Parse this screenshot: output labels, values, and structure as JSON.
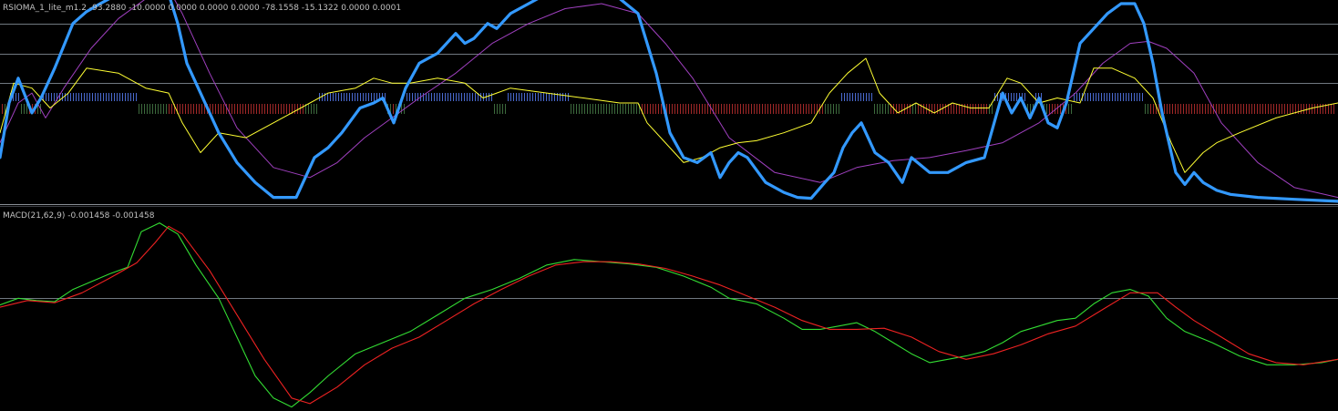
{
  "chart_data": [
    {
      "type": "line",
      "label": "RSIOMA_1_lite_m1.2 -93.2880 -10.0000 0.0000 0.0000 0.0000 -78.1558 -15.1322 0.0000 0.0001",
      "levels": [
        80,
        50,
        20
      ],
      "ylim": [
        -100,
        100
      ],
      "colors": {
        "rsioma": "#3399ff",
        "ma": "#a040c0",
        "signal": "#ffff33",
        "level": "#707880",
        "histogram_up": "#4a6ad0",
        "histogram_down": "#a02828",
        "histogram_neutral": "#3d6a3d"
      },
      "series": [
        {
          "key": "rsioma",
          "x": [
            0,
            10,
            20,
            35,
            45,
            60,
            80,
            95,
            110,
            130,
            160,
            185,
            195,
            205,
            220,
            240,
            260,
            280,
            300,
            325,
            335,
            345,
            360,
            375,
            395,
            410,
            420,
            432,
            445,
            460,
            480,
            500,
            510,
            520,
            535,
            545,
            560,
            580,
            600,
            620,
            640,
            660,
            680,
            700,
            710,
            720,
            735,
            750,
            765,
            780,
            790,
            800,
            810,
            820,
            840,
            860,
            875,
            890,
            905,
            915,
            925,
            935,
            945,
            960,
            975,
            990,
            1000,
            1020,
            1040,
            1060,
            1080,
            1100,
            1110,
            1120,
            1130,
            1140,
            1150,
            1160,
            1170,
            1185,
            1200,
            1215,
            1230,
            1245,
            1255,
            1265,
            1275,
            1290,
            1300,
            1310,
            1320,
            1335,
            1350,
            1380,
            1420,
            1468
          ],
          "values": [
            -55,
            0,
            25,
            -10,
            5,
            35,
            80,
            92,
            100,
            110,
            120,
            110,
            80,
            40,
            10,
            -30,
            -60,
            -80,
            -95,
            -95,
            -75,
            -55,
            -45,
            -30,
            -5,
            0,
            5,
            -20,
            15,
            40,
            50,
            70,
            60,
            65,
            80,
            75,
            90,
            100,
            110,
            115,
            110,
            112,
            105,
            90,
            60,
            30,
            -30,
            -55,
            -60,
            -50,
            -75,
            -60,
            -50,
            -55,
            -80,
            -90,
            -95,
            -96,
            -80,
            -70,
            -45,
            -30,
            -20,
            -50,
            -60,
            -80,
            -55,
            -70,
            -70,
            -60,
            -55,
            10,
            -10,
            5,
            -15,
            5,
            -20,
            -25,
            0,
            60,
            75,
            90,
            100,
            100,
            80,
            40,
            -10,
            -70,
            -82,
            -70,
            -80,
            -88,
            -92,
            -95,
            -97,
            -99
          ]
        },
        {
          "key": "ma",
          "x": [
            0,
            20,
            35,
            50,
            70,
            100,
            130,
            160,
            185,
            200,
            230,
            260,
            300,
            340,
            370,
            400,
            430,
            460,
            500,
            540,
            580,
            620,
            660,
            700,
            730,
            760,
            800,
            850,
            900,
            940,
            980,
            1020,
            1060,
            1100,
            1140,
            1180,
            1210,
            1240,
            1260,
            1280,
            1310,
            1340,
            1380,
            1420,
            1468
          ],
          "values": [
            -40,
            0,
            10,
            -15,
            15,
            55,
            85,
            105,
            115,
            90,
            30,
            -25,
            -65,
            -75,
            -60,
            -35,
            -15,
            5,
            30,
            60,
            80,
            95,
            100,
            90,
            60,
            25,
            -35,
            -70,
            -80,
            -65,
            -58,
            -55,
            -48,
            -40,
            -20,
            10,
            40,
            60,
            62,
            55,
            30,
            -20,
            -60,
            -85,
            -95
          ]
        },
        {
          "key": "signal",
          "x": [
            0,
            15,
            35,
            55,
            75,
            95,
            130,
            160,
            185,
            200,
            220,
            240,
            270,
            300,
            330,
            360,
            390,
            410,
            430,
            450,
            480,
            510,
            530,
            545,
            560,
            600,
            640,
            680,
            700,
            710,
            730,
            750,
            770,
            790,
            810,
            830,
            860,
            890,
            910,
            930,
            950,
            965,
            985,
            1005,
            1025,
            1045,
            1065,
            1085,
            1105,
            1120,
            1140,
            1160,
            1185,
            1200,
            1220,
            1245,
            1265,
            1285,
            1300,
            1320,
            1335,
            1360,
            1400,
            1440,
            1468
          ],
          "values": [
            -30,
            20,
            15,
            -5,
            10,
            35,
            30,
            15,
            10,
            -20,
            -50,
            -30,
            -35,
            -20,
            -5,
            10,
            15,
            25,
            20,
            20,
            25,
            20,
            5,
            10,
            15,
            10,
            5,
            0,
            0,
            -20,
            -40,
            -60,
            -55,
            -45,
            -40,
            -38,
            -30,
            -20,
            10,
            30,
            45,
            10,
            -10,
            0,
            -10,
            0,
            -5,
            -5,
            25,
            20,
            0,
            5,
            0,
            35,
            35,
            25,
            5,
            -40,
            -70,
            -50,
            -40,
            -30,
            -15,
            -5,
            0
          ]
        }
      ]
    },
    {
      "type": "line",
      "label": "MACD(21,62,9) -0.001458 -0.001458",
      "levels": [
        0
      ],
      "ylim": [
        -0.01,
        0.008
      ],
      "colors": {
        "macd": "#33dd33",
        "signal": "#ee2222",
        "level": "#707880"
      },
      "series": [
        {
          "key": "macd",
          "x": [
            0,
            20,
            40,
            60,
            80,
            100,
            120,
            140,
            155,
            175,
            195,
            215,
            240,
            260,
            280,
            300,
            320,
            340,
            360,
            390,
            420,
            450,
            480,
            510,
            540,
            570,
            600,
            630,
            660,
            690,
            720,
            750,
            780,
            800,
            830,
            860,
            880,
            900,
            920,
            940,
            960,
            980,
            1000,
            1020,
            1040,
            1060,
            1080,
            1100,
            1120,
            1140,
            1160,
            1180,
            1200,
            1220,
            1240,
            1260,
            1280,
            1300,
            1330,
            1360,
            1390,
            1420,
            1450,
            1468
          ],
          "values": [
            -0.0006,
            0,
            -0.0002,
            -0.0003,
            0.0008,
            0.0015,
            0.0022,
            0.0028,
            0.006,
            0.0068,
            0.0058,
            0.003,
            0,
            -0.0035,
            -0.007,
            -0.009,
            -0.0098,
            -0.0085,
            -0.007,
            -0.005,
            -0.004,
            -0.003,
            -0.0015,
            0,
            0.0008,
            0.0018,
            0.003,
            0.0035,
            0.0033,
            0.0031,
            0.0028,
            0.002,
            0.001,
            0,
            -0.0005,
            -0.0018,
            -0.0028,
            -0.0028,
            -0.0025,
            -0.0022,
            -0.003,
            -0.004,
            -0.005,
            -0.0058,
            -0.0055,
            -0.0052,
            -0.0048,
            -0.004,
            -0.003,
            -0.0025,
            -0.002,
            -0.0018,
            -0.0005,
            0.0005,
            0.0008,
            0.0002,
            -0.0018,
            -0.003,
            -0.004,
            -0.0052,
            -0.006,
            -0.006,
            -0.0058,
            -0.0055
          ]
        },
        {
          "key": "signal",
          "x": [
            0,
            30,
            60,
            90,
            120,
            150,
            170,
            185,
            200,
            230,
            260,
            290,
            320,
            340,
            370,
            400,
            430,
            460,
            490,
            520,
            550,
            580,
            610,
            640,
            670,
            700,
            730,
            760,
            790,
            820,
            850,
            880,
            910,
            940,
            970,
            1000,
            1030,
            1060,
            1090,
            1120,
            1150,
            1180,
            1210,
            1240,
            1270,
            1290,
            1310,
            1340,
            1370,
            1400,
            1430,
            1468
          ],
          "values": [
            -0.0008,
            -0.0002,
            -0.0004,
            0.0005,
            0.0018,
            0.0032,
            0.005,
            0.0065,
            0.0058,
            0.0025,
            -0.0015,
            -0.0055,
            -0.009,
            -0.0095,
            -0.008,
            -0.006,
            -0.0045,
            -0.0035,
            -0.002,
            -0.0005,
            0.0008,
            0.002,
            0.003,
            0.0033,
            0.0033,
            0.0031,
            0.0027,
            0.002,
            0.0012,
            0.0002,
            -0.0008,
            -0.002,
            -0.0028,
            -0.0028,
            -0.0027,
            -0.0035,
            -0.0048,
            -0.0055,
            -0.005,
            -0.0042,
            -0.0032,
            -0.0025,
            -0.001,
            0.0005,
            0.0005,
            -0.0008,
            -0.002,
            -0.0035,
            -0.005,
            -0.0058,
            -0.006,
            -0.0055
          ]
        }
      ]
    }
  ]
}
